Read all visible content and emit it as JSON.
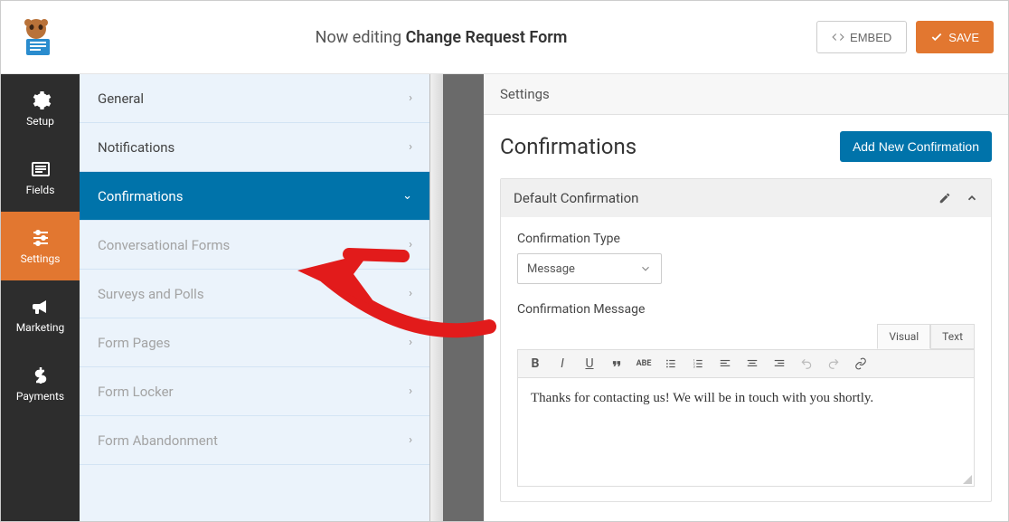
{
  "topbar": {
    "editing_prefix": "Now editing ",
    "form_name": "Change Request Form",
    "embed_label": "EMBED",
    "save_label": "SAVE"
  },
  "iconbar": {
    "items": [
      {
        "label": "Setup"
      },
      {
        "label": "Fields"
      },
      {
        "label": "Settings"
      },
      {
        "label": "Marketing"
      },
      {
        "label": "Payments"
      }
    ]
  },
  "subnav": {
    "items": [
      {
        "label": "General"
      },
      {
        "label": "Notifications"
      },
      {
        "label": "Confirmations"
      },
      {
        "label": "Conversational Forms"
      },
      {
        "label": "Surveys and Polls"
      },
      {
        "label": "Form Pages"
      },
      {
        "label": "Form Locker"
      },
      {
        "label": "Form Abandonment"
      }
    ]
  },
  "main": {
    "header": "Settings",
    "title": "Confirmations",
    "add_button": "Add New Confirmation",
    "panel_title": "Default Confirmation",
    "type_label": "Confirmation Type",
    "type_value": "Message",
    "message_label": "Confirmation Message",
    "tabs": {
      "visual": "Visual",
      "text": "Text"
    },
    "editor_content": "Thanks for contacting us! We will be in touch with you shortly."
  }
}
